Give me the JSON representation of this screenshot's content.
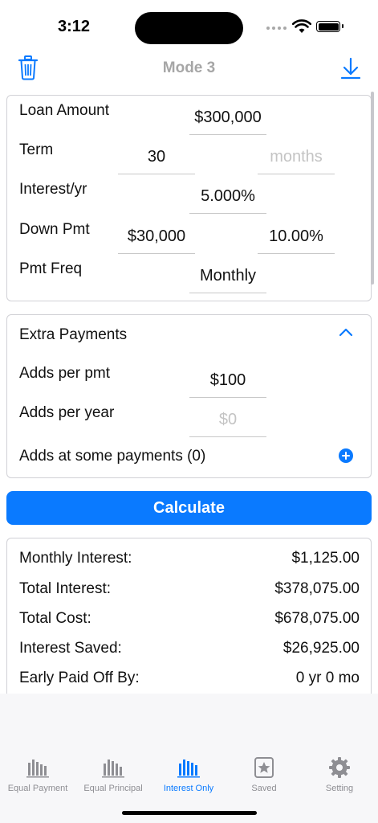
{
  "status": {
    "time": "3:12"
  },
  "nav": {
    "title": "Mode 3",
    "left_icon": "trash-icon",
    "right_icon": "download-icon"
  },
  "loan": {
    "amount_label": "Loan Amount",
    "amount_value": "$300,000",
    "term_label": "Term",
    "term_value": "30",
    "term_months_placeholder": "months",
    "interest_label": "Interest/yr",
    "interest_value": "5.000%",
    "down_label": "Down Pmt",
    "down_value": "$30,000",
    "down_percent": "10.00%",
    "freq_label": "Pmt Freq",
    "freq_value": "Monthly"
  },
  "extra": {
    "title": "Extra Payments",
    "per_pmt_label": "Adds per pmt",
    "per_pmt_value": "$100",
    "per_year_label": "Adds per year",
    "per_year_placeholder": "$0",
    "some_label": "Adds at some payments (0)"
  },
  "calculate_label": "Calculate",
  "results": [
    {
      "label": "Monthly Interest:",
      "value": "$1,125.00"
    },
    {
      "label": "Total Interest:",
      "value": "$378,075.00"
    },
    {
      "label": "Total Cost:",
      "value": "$678,075.00"
    },
    {
      "label": "Interest Saved:",
      "value": "$26,925.00"
    },
    {
      "label": "Early Paid Off By:",
      "value": "0 yr 0 mo"
    }
  ],
  "tabs": [
    {
      "label": "Equal Payment",
      "icon": "bar-chart-icon"
    },
    {
      "label": "Equal Principal",
      "icon": "bar-chart-icon"
    },
    {
      "label": "Interest Only",
      "icon": "bar-chart-icon",
      "active": true
    },
    {
      "label": "Saved",
      "icon": "star-square-icon"
    },
    {
      "label": "Setting",
      "icon": "gear-icon"
    }
  ],
  "colors": {
    "accent": "#0a7aff",
    "inactive": "#8e8e93",
    "placeholder": "#c4c4c4"
  }
}
